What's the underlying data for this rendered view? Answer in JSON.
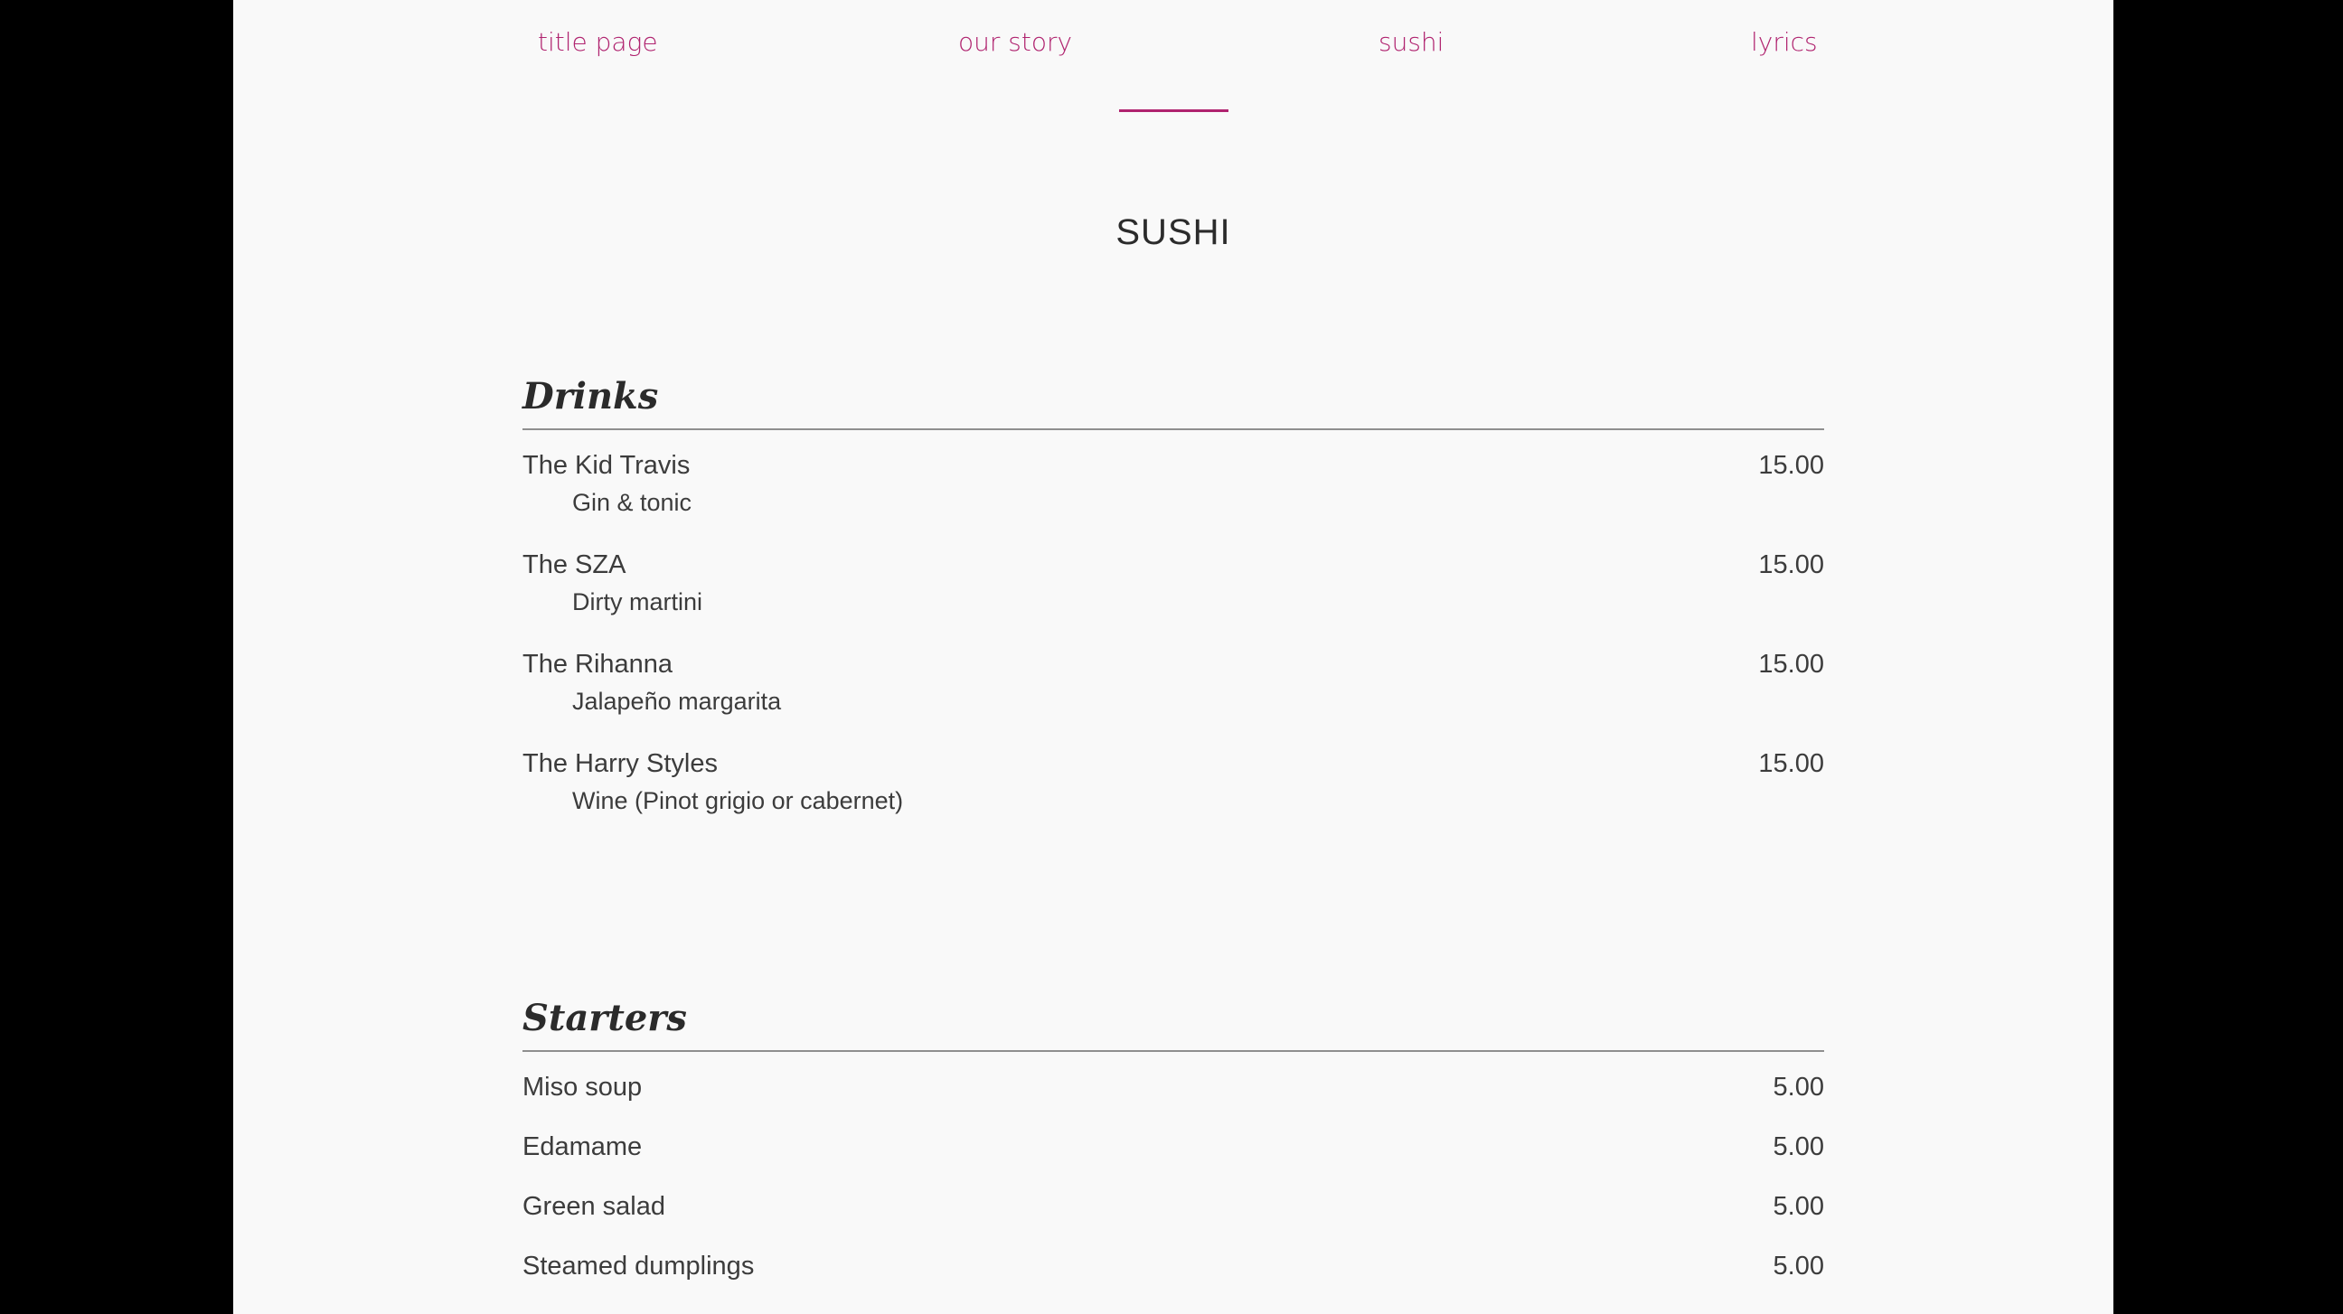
{
  "nav": {
    "items": [
      {
        "label": "title page"
      },
      {
        "label": "our story"
      },
      {
        "label": "sushi"
      },
      {
        "label": "lyrics"
      }
    ]
  },
  "page": {
    "title": "SUSHI"
  },
  "sections": [
    {
      "heading": "Drinks",
      "items": [
        {
          "name": "The Kid Travis",
          "price": "15.00",
          "description": "Gin & tonic"
        },
        {
          "name": "The SZA",
          "price": "15.00",
          "description": "Dirty martini"
        },
        {
          "name": "The Rihanna",
          "price": "15.00",
          "description": "Jalapeño margarita"
        },
        {
          "name": "The Harry Styles",
          "price": "15.00",
          "description": "Wine (Pinot grigio or cabernet)"
        }
      ]
    },
    {
      "heading": "Starters",
      "items": [
        {
          "name": "Miso soup",
          "price": "5.00"
        },
        {
          "name": "Edamame",
          "price": "5.00"
        },
        {
          "name": "Green salad",
          "price": "5.00"
        },
        {
          "name": "Steamed dumplings",
          "price": "5.00"
        }
      ]
    }
  ],
  "colors": {
    "accent": "#b0236f",
    "background": "#f9f9f9",
    "text": "#3c3c3c",
    "rule": "#8f8f8f",
    "outer": "#000000"
  }
}
